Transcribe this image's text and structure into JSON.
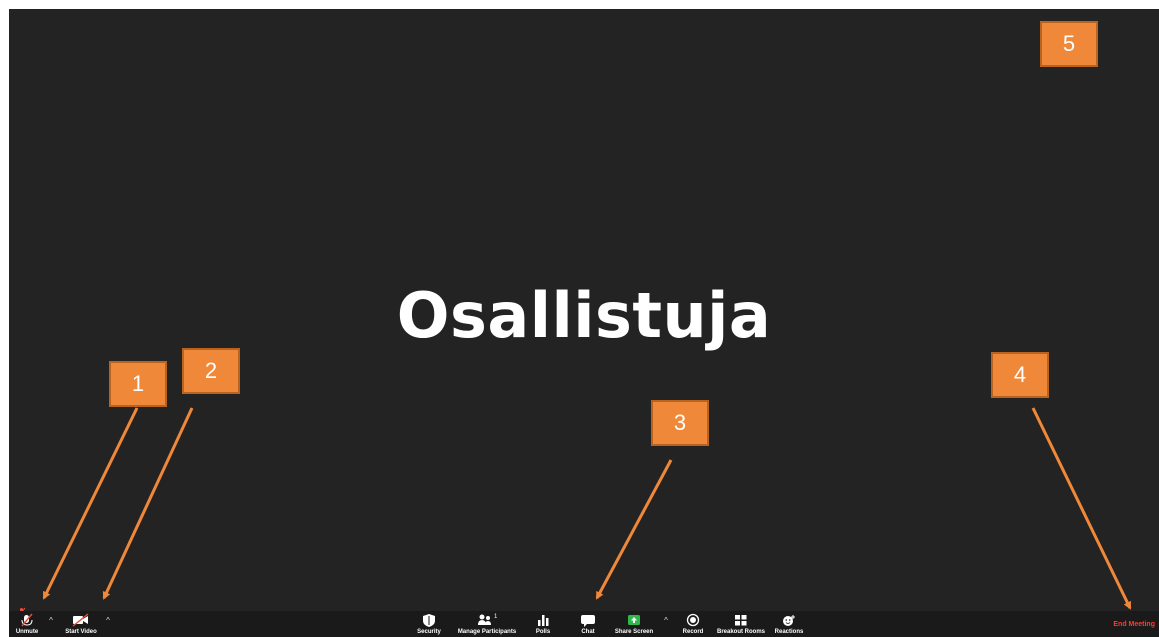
{
  "meeting": {
    "participant_name": "Osallistuja"
  },
  "toolbar": {
    "unmute_label": "Unmute",
    "start_video_label": "Start Video",
    "security_label": "Security",
    "manage_participants_label": "Manage Participants",
    "participants_count": "1",
    "polls_label": "Polls",
    "chat_label": "Chat",
    "share_screen_label": "Share Screen",
    "record_label": "Record",
    "breakout_rooms_label": "Breakout Rooms",
    "reactions_label": "Reactions",
    "end_meeting_label": "End Meeting"
  },
  "annotations": {
    "badge_1": "1",
    "badge_2": "2",
    "badge_3": "3",
    "badge_4": "4",
    "badge_5": "5"
  },
  "colors": {
    "stage_background": "#232323",
    "toolbar_background": "#1a1a1a",
    "badge_fill": "#f0883a",
    "end_meeting_text": "#ff3b30",
    "share_screen_green": "#2db84b"
  },
  "icons": {
    "unmute": "muted-microphone-icon",
    "start_video": "video-off-icon",
    "security": "shield-icon",
    "manage_participants": "participants-icon",
    "polls": "bar-chart-icon",
    "chat": "chat-bubble-icon",
    "share_screen": "share-screen-icon",
    "record": "record-icon",
    "breakout_rooms": "grid-icon",
    "reactions": "smiley-add-icon"
  }
}
